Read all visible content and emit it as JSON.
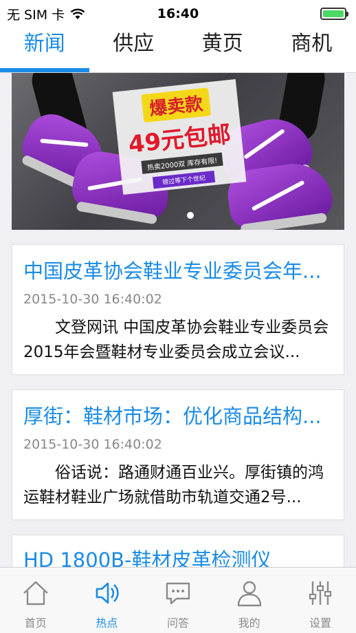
{
  "status_bar": {
    "carrier": "无 SIM 卡",
    "time": "16:40"
  },
  "top_tabs": [
    {
      "label": "新闻",
      "active": true
    },
    {
      "label": "供应",
      "active": false
    },
    {
      "label": "黄页",
      "active": false
    },
    {
      "label": "商机",
      "active": false
    }
  ],
  "banner": {
    "title": "爆卖款",
    "price": "49元包邮",
    "subtitle": "热卖2000双 库存有限!",
    "tag": "错过等下个世纪",
    "page_index": 1,
    "page_count": 1
  },
  "news": [
    {
      "title": "中国皮革协会鞋业专业委员会年...",
      "date": "2015-10-30 16:40:02",
      "summary": "文登网讯 中国皮革协会鞋业专业委员会2015年会暨鞋材专业委员会成立会议..."
    },
    {
      "title": "厚街：鞋材市场：优化商品结构...",
      "date": "2015-10-30 16:40:02",
      "summary": "俗话说：路通财通百业兴。厚街镇的鸿运鞋材鞋业广场就借助市轨道交通2号..."
    },
    {
      "title": "HD 1800B-鞋材皮革检测仪",
      "date": "",
      "summary": ""
    }
  ],
  "bottom_nav": [
    {
      "label": "首页",
      "icon": "home-icon",
      "active": false
    },
    {
      "label": "热点",
      "icon": "broadcast-icon",
      "active": true
    },
    {
      "label": "问答",
      "icon": "chat-icon",
      "active": false
    },
    {
      "label": "我的",
      "icon": "user-icon",
      "active": false
    },
    {
      "label": "设置",
      "icon": "settings-sliders-icon",
      "active": false
    }
  ],
  "colors": {
    "accent": "#1a8be6",
    "inactive": "#8a8a8a",
    "background": "#efeff4"
  }
}
